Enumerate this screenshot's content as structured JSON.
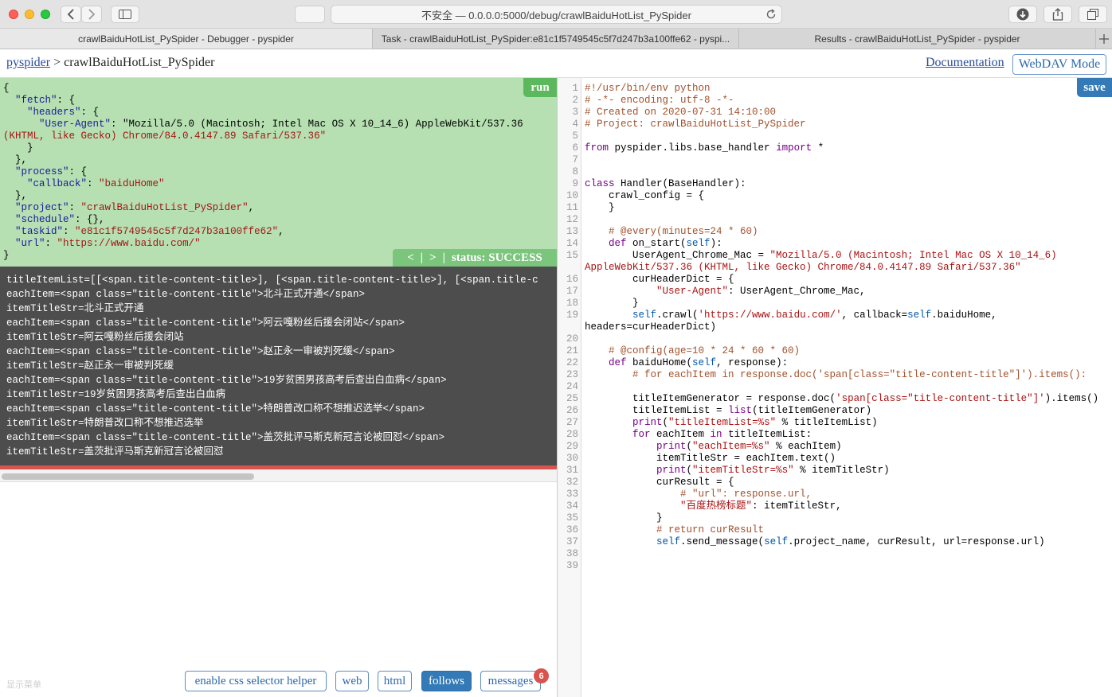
{
  "browser": {
    "address": "不安全 — 0.0.0.0:5000/debug/crawlBaiduHotList_PySpider",
    "tabs": [
      {
        "label": "crawlBaiduHotList_PySpider - Debugger - pyspider"
      },
      {
        "label": "Task - crawlBaiduHotList_PySpider:e81c1f5749545c5f7d247b3a100ffe62 - pyspi..."
      },
      {
        "label": "Results - crawlBaiduHotList_PySpider - pyspider"
      }
    ]
  },
  "header": {
    "root_link": "pyspider",
    "separator": " > ",
    "project": "crawlBaiduHotList_PySpider",
    "documentation": "Documentation",
    "webdav": "WebDAV Mode"
  },
  "task": {
    "run_label": "run",
    "lines": [
      "{",
      "  \"fetch\": {",
      "    \"headers\": {",
      "      \"User-Agent\": \"Mozilla/5.0 (Macintosh; Intel Mac OS X 10_14_6) AppleWebKit/537.36",
      "(KHTML, like Gecko) Chrome/84.0.4147.89 Safari/537.36\"",
      "    }",
      "  },",
      "  \"process\": {",
      "    \"callback\": \"baiduHome\"",
      "  },",
      "  \"project\": \"crawlBaiduHotList_PySpider\",",
      "  \"schedule\": {},",
      "  \"taskid\": \"e81c1f5749545c5f7d247b3a100ffe62\",",
      "  \"url\": \"https://www.baidu.com/\"",
      "}"
    ],
    "nav_prev": "<",
    "nav_sep": "|",
    "nav_next": ">",
    "status": "status: SUCCESS"
  },
  "output": {
    "lines": [
      "titleItemList=[[<span.title-content-title>], [<span.title-content-title>], [<span.title-c",
      "eachItem=<span class=\"title-content-title\">北斗正式开通</span>",
      "itemTitleStr=北斗正式开通",
      "eachItem=<span class=\"title-content-title\">阿云嘎粉丝后援会闭站</span>",
      "itemTitleStr=阿云嘎粉丝后援会闭站",
      "eachItem=<span class=\"title-content-title\">赵正永一审被判死缓</span>",
      "itemTitleStr=赵正永一审被判死缓",
      "eachItem=<span class=\"title-content-title\">19岁贫困男孩高考后查出白血病</span>",
      "itemTitleStr=19岁贫困男孩高考后查出白血病",
      "eachItem=<span class=\"title-content-title\">特朗普改口称不想推迟选举</span>",
      "itemTitleStr=特朗普改口称不想推迟选举",
      "eachItem=<span class=\"title-content-title\">盖茨批评马斯克新冠言论被回怼</span>",
      "itemTitleStr=盖茨批评马斯克新冠言论被回怼"
    ],
    "hint": "显示菜单"
  },
  "toolbar": {
    "css_helper": "enable css selector helper",
    "web": "web",
    "html": "html",
    "follows": "follows",
    "messages": "messages",
    "messages_count": "6"
  },
  "editor": {
    "save_label": "save",
    "lines": [
      {
        "n": "1",
        "t": "#!/usr/bin/env python"
      },
      {
        "n": "2",
        "t": "# -*- encoding: utf-8 -*-"
      },
      {
        "n": "3",
        "t": "# Created on 2020-07-31 14:10:00"
      },
      {
        "n": "4",
        "t": "# Project: crawlBaiduHotList_PySpider"
      },
      {
        "n": "5",
        "t": ""
      },
      {
        "n": "6",
        "t": "from pyspider.libs.base_handler import *"
      },
      {
        "n": "7",
        "t": ""
      },
      {
        "n": "8",
        "t": ""
      },
      {
        "n": "9",
        "t": "class Handler(BaseHandler):"
      },
      {
        "n": "10",
        "t": "    crawl_config = {"
      },
      {
        "n": "11",
        "t": "    }"
      },
      {
        "n": "12",
        "t": ""
      },
      {
        "n": "13",
        "t": "    # @every(minutes=24 * 60)"
      },
      {
        "n": "14",
        "t": "    def on_start(self):"
      },
      {
        "n": "15",
        "t": "        UserAgent_Chrome_Mac = \"Mozilla/5.0 (Macintosh; Intel Mac OS X 10_14_6) AppleWebKit/537.36 (KHTML, like Gecko) Chrome/84.0.4147.89 Safari/537.36\""
      },
      {
        "n": "16",
        "t": "        curHeaderDict = {"
      },
      {
        "n": "17",
        "t": "            \"User-Agent\": UserAgent_Chrome_Mac,"
      },
      {
        "n": "18",
        "t": "        }"
      },
      {
        "n": "19",
        "t": "        self.crawl('https://www.baidu.com/', callback=self.baiduHome, headers=curHeaderDict)"
      },
      {
        "n": "20",
        "t": ""
      },
      {
        "n": "21",
        "t": "    # @config(age=10 * 24 * 60 * 60)"
      },
      {
        "n": "22",
        "t": "    def baiduHome(self, response):"
      },
      {
        "n": "23",
        "t": "        # for eachItem in response.doc('span[class=\"title-content-title\"]').items():"
      },
      {
        "n": "24",
        "t": ""
      },
      {
        "n": "25",
        "t": "        titleItemGenerator = response.doc('span[class=\"title-content-title\"]').items()"
      },
      {
        "n": "26",
        "t": "        titleItemList = list(titleItemGenerator)"
      },
      {
        "n": "27",
        "t": "        print(\"titleItemList=%s\" % titleItemList)"
      },
      {
        "n": "28",
        "t": "        for eachItem in titleItemList:"
      },
      {
        "n": "29",
        "t": "            print(\"eachItem=%s\" % eachItem)"
      },
      {
        "n": "30",
        "t": "            itemTitleStr = eachItem.text()"
      },
      {
        "n": "31",
        "t": "            print(\"itemTitleStr=%s\" % itemTitleStr)"
      },
      {
        "n": "32",
        "t": "            curResult = {"
      },
      {
        "n": "33",
        "t": "                # \"url\": response.url,"
      },
      {
        "n": "34",
        "t": "                \"百度热榜标题\": itemTitleStr,"
      },
      {
        "n": "35",
        "t": "            }"
      },
      {
        "n": "36",
        "t": "            # return curResult"
      },
      {
        "n": "37",
        "t": "            self.send_message(self.project_name, curResult, url=response.url)"
      },
      {
        "n": "38",
        "t": ""
      },
      {
        "n": "39",
        "t": ""
      }
    ]
  },
  "colors": {
    "task_bg": "#b6e0b2",
    "output_bg": "#4d4d4d",
    "accent_blue": "#337ab7",
    "status_green": "#7cc57d",
    "error_red": "#d9534f"
  }
}
